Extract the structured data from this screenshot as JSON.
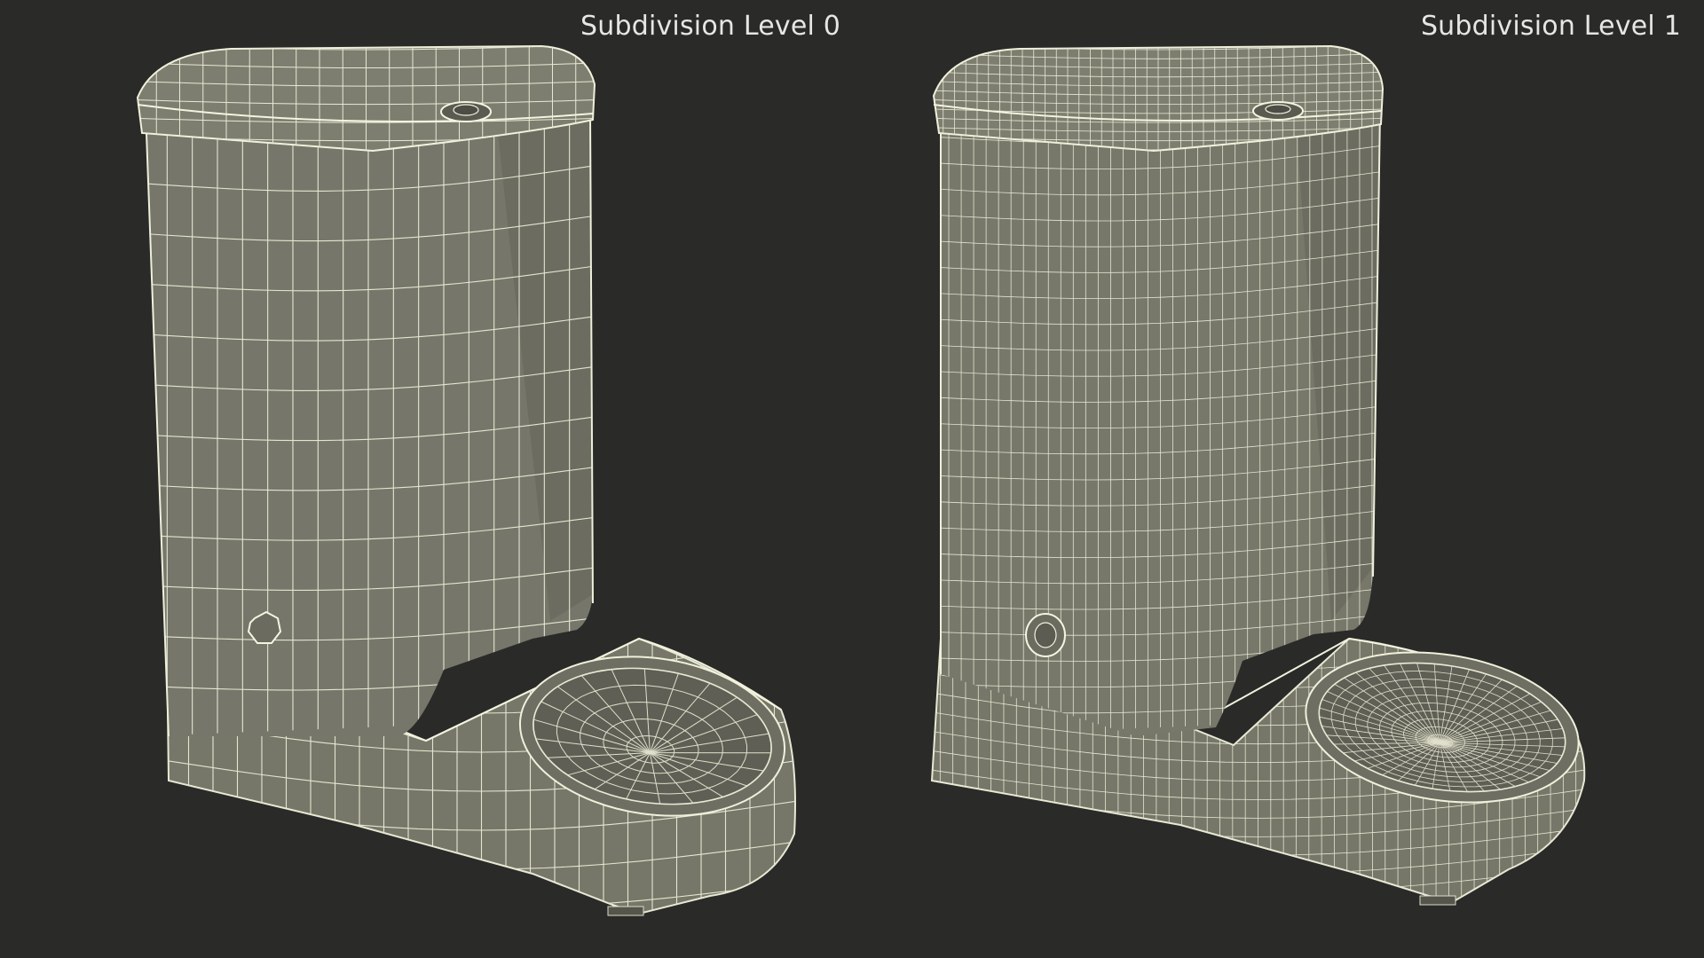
{
  "labels": {
    "left": "Subdivision Level 0",
    "right": "Subdivision Level 1"
  },
  "colors": {
    "background": "#2a2a29",
    "surface": "#7a7a6c",
    "surface_dark": "#65655a",
    "wire": "#eeeeda"
  },
  "models": [
    {
      "id": "level-0",
      "grid_density": 1
    },
    {
      "id": "level-1",
      "grid_density": 2
    }
  ]
}
